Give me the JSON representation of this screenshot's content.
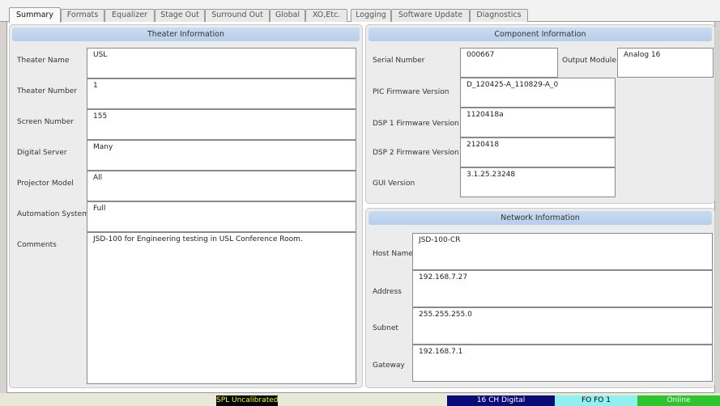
{
  "tabs": [
    {
      "label": "Summary"
    },
    {
      "label": "Formats"
    },
    {
      "label": "Equalizer"
    },
    {
      "label": "Stage Out"
    },
    {
      "label": "Surround Out"
    },
    {
      "label": "Global"
    },
    {
      "label": "XO,Etc."
    },
    {
      "label": "Logging"
    },
    {
      "label": "Software Update"
    },
    {
      "label": "Diagnostics"
    }
  ],
  "active_tab": "Summary",
  "theater": {
    "header": "Theater Information",
    "fields": [
      {
        "label": "Theater Name",
        "value": "USL"
      },
      {
        "label": "Theater Number",
        "value": "1"
      },
      {
        "label": "Screen Number",
        "value": "155"
      },
      {
        "label": "Digital Server",
        "value": "Many"
      },
      {
        "label": "Projector Model",
        "value": "All"
      },
      {
        "label": "Automation System",
        "value": "Full"
      },
      {
        "label": "Comments",
        "value": "JSD-100 for Engineering testing in USL Conference Room."
      }
    ]
  },
  "component": {
    "header": "Component Information",
    "serial_label": "Serial Number",
    "serial_value": "000667",
    "output_module_label": "Output Module",
    "output_module_value": "Analog 16",
    "fields": [
      {
        "label": "PIC Firmware Version",
        "value": "D_120425-A_110829-A_0"
      },
      {
        "label": "DSP 1 Firmware Version",
        "value": "1120418a"
      },
      {
        "label": "DSP 2 Firmware Version",
        "value": "2120418"
      },
      {
        "label": "GUI Version",
        "value": "3.1.25.23248"
      }
    ]
  },
  "network": {
    "header": "Network Information",
    "fields": [
      {
        "label": "Host Name",
        "value": "JSD-100-CR"
      },
      {
        "label": "Address",
        "value": "192.168.7.27"
      },
      {
        "label": "Subnet",
        "value": "255.255.255.0"
      },
      {
        "label": "Gateway",
        "value": "192.168.7.1"
      }
    ]
  },
  "status": {
    "spl": "SPL Uncalibrated",
    "channels": "16 CH Digital",
    "format": "FO FO 1",
    "connection": "Online"
  },
  "colors": {
    "spl_bg": "#000000",
    "spl_fg": "#ffff00",
    "channels_bg": "#0a0a78",
    "channels_fg": "#ffffff",
    "format_bg": "#8ff0f0",
    "format_fg": "#000000",
    "online_bg": "#2ec42e",
    "online_fg": "#ffffff"
  }
}
